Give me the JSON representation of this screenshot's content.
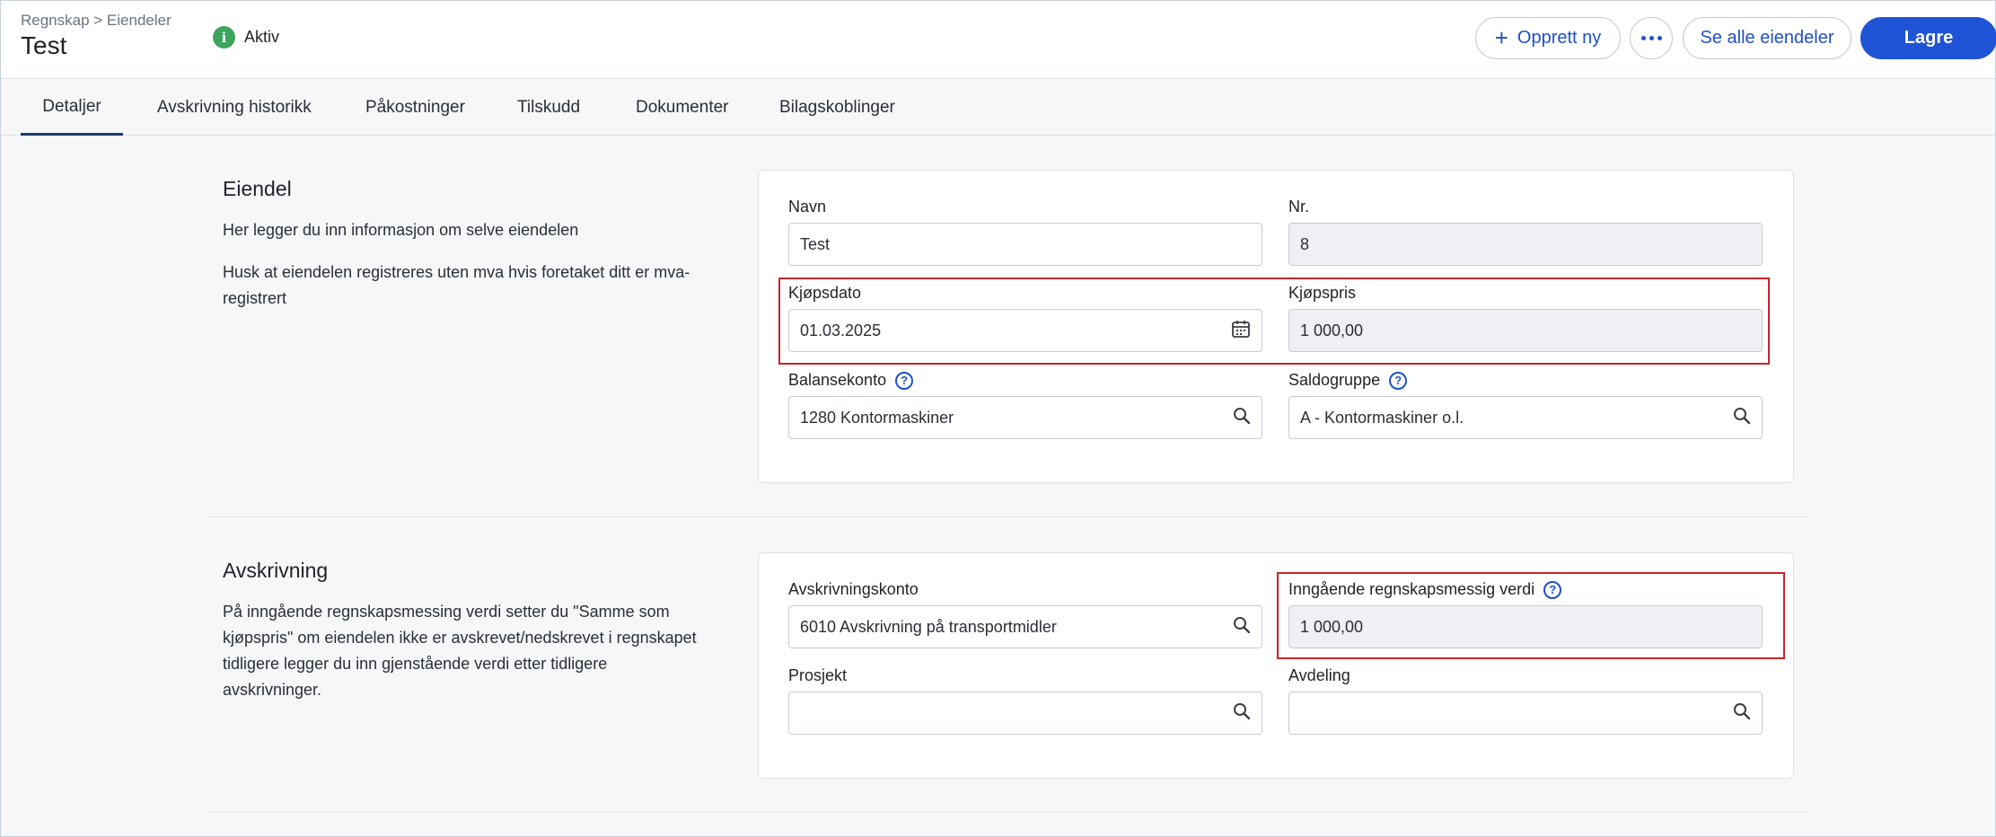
{
  "header": {
    "breadcrumb": "Regnskap > Eiendeler",
    "title": "Test",
    "status": "Aktiv",
    "status_icon": "info-icon",
    "buttons": {
      "create_new": "Opprett ny",
      "more": "more-icon",
      "see_all": "Se alle eiendeler",
      "save": "Lagre"
    }
  },
  "tabs": [
    {
      "label": "Detaljer",
      "active": true
    },
    {
      "label": "Avskrivning historikk",
      "active": false
    },
    {
      "label": "Påkostninger",
      "active": false
    },
    {
      "label": "Tilskudd",
      "active": false
    },
    {
      "label": "Dokumenter",
      "active": false
    },
    {
      "label": "Bilagskoblinger",
      "active": false
    }
  ],
  "asset_section": {
    "title": "Eiendel",
    "description_1": "Her legger du inn informasjon om selve eiendelen",
    "description_2": "Husk at eiendelen registreres uten mva hvis foretaket ditt er mva-registrert",
    "fields": {
      "name": {
        "label": "Navn",
        "value": "Test"
      },
      "number": {
        "label": "Nr.",
        "value": "8"
      },
      "purchase_date": {
        "label": "Kjøpsdato",
        "value": "01.03.2025"
      },
      "purchase_price": {
        "label": "Kjøpspris",
        "value": "1 000,00"
      },
      "balance_account": {
        "label": "Balansekonto",
        "value": "1280 Kontormaskiner"
      },
      "balance_group": {
        "label": "Saldogruppe",
        "value": "A - Kontormaskiner o.l."
      }
    }
  },
  "depreciation_section": {
    "title": "Avskrivning",
    "description": "På inngående regnskapsmessing verdi setter du \"Samme som kjøpspris\" om eiendelen ikke er avskrevet/nedskrevet i regnskapet tidligere legger du inn gjenstående verdi etter tidligere avskrivninger.",
    "fields": {
      "depreciation_account": {
        "label": "Avskrivningskonto",
        "value": "6010 Avskrivning på transportmidler"
      },
      "opening_value": {
        "label": "Inngående regnskapsmessig verdi",
        "value": "1 000,00"
      },
      "project": {
        "label": "Prosjekt",
        "value": ""
      },
      "department": {
        "label": "Avdeling",
        "value": ""
      }
    }
  },
  "colors": {
    "primary": "#1f54d6",
    "active_status": "#3da35d",
    "highlight": "#c8242b"
  }
}
